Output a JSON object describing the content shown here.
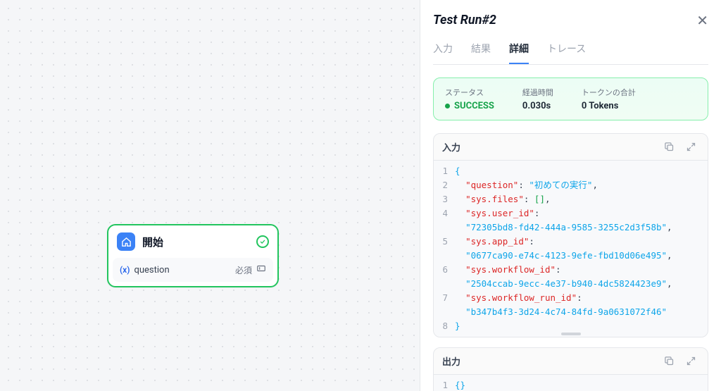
{
  "node": {
    "title": "開始",
    "variable": {
      "badge": "(x)",
      "name": "question",
      "required": "必須"
    }
  },
  "panel": {
    "title": "Test Run#2",
    "tabs": [
      {
        "id": "input",
        "label": "入力",
        "active": false
      },
      {
        "id": "result",
        "label": "結果",
        "active": false
      },
      {
        "id": "detail",
        "label": "詳細",
        "active": true
      },
      {
        "id": "trace",
        "label": "トレース",
        "active": false
      }
    ],
    "status": {
      "status_label": "ステータス",
      "status_value": "SUCCESS",
      "elapsed_label": "経過時間",
      "elapsed_value": "0.030s",
      "tokens_label": "トークンの合計",
      "tokens_value": "0 Tokens"
    },
    "input_section": {
      "title": "入力",
      "lines": [
        "1",
        "2",
        "3",
        "4",
        "5",
        "6",
        "7",
        "8"
      ],
      "json": {
        "question": "初めての実行",
        "sys.files": [],
        "sys.user_id": "72305bd8-fd42-444a-9585-3255c2d3f58b",
        "sys.app_id": "0677ca90-e74c-4123-9efe-fbd10d06e495",
        "sys.workflow_id": "2504ccab-9ecc-4e37-b940-4dc5824423e9",
        "sys.workflow_run_id": "b347b4f3-3d24-4c74-84fd-9a0631072f46"
      }
    },
    "output_section": {
      "title": "出力",
      "lines": [
        "1"
      ],
      "json": {}
    }
  }
}
